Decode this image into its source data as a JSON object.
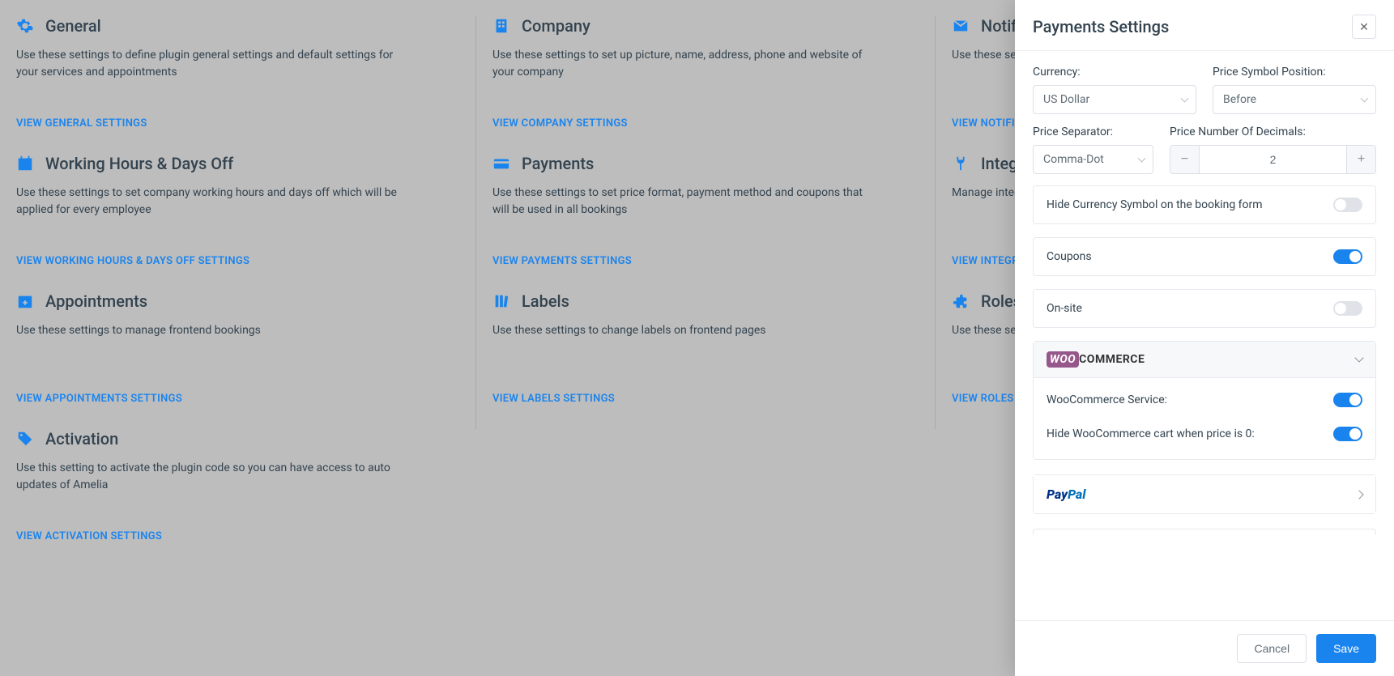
{
  "cards": [
    {
      "icon": "gear",
      "title": "General",
      "desc": "Use these settings to define plugin general settings and default settings for your services and appointments",
      "link": "VIEW GENERAL SETTINGS"
    },
    {
      "icon": "building",
      "title": "Company",
      "desc": "Use these settings to set up picture, name, address, phone and website of your company",
      "link": "VIEW COMPANY SETTINGS"
    },
    {
      "icon": "envelope",
      "title": "Notifications",
      "desc": "Use these settings to configure what notifications are sent to customers",
      "link": "VIEW NOTIFICATIONS SETTINGS"
    },
    {
      "icon": "calendar",
      "title": "Working Hours & Days Off",
      "desc": "Use these settings to set company working hours and days off which will be applied for every employee",
      "link": "VIEW WORKING HOURS & DAYS OFF SETTINGS"
    },
    {
      "icon": "card",
      "title": "Payments",
      "desc": "Use these settings to set price format, payment method and coupons that will be used in all bookings",
      "link": "VIEW PAYMENTS SETTINGS"
    },
    {
      "icon": "plug",
      "title": "Integrations",
      "desc": "Manage integrations",
      "link": "VIEW INTEGRATIONS SETTINGS"
    },
    {
      "icon": "cal-plus",
      "title": "Appointments",
      "desc": "Use these settings to manage frontend bookings",
      "link": "VIEW APPOINTMENTS SETTINGS"
    },
    {
      "icon": "books",
      "title": "Labels",
      "desc": "Use these settings to change labels on frontend pages",
      "link": "VIEW LABELS SETTINGS"
    },
    {
      "icon": "puzzle",
      "title": "Roles",
      "desc": "Use these settings to manage roles",
      "link": "VIEW ROLES SETTINGS"
    },
    {
      "icon": "tag",
      "title": "Activation",
      "desc": "Use this setting to activate the plugin code so you can have access to auto updates of Amelia",
      "link": "VIEW ACTIVATION SETTINGS"
    }
  ],
  "panel": {
    "title": "Payments Settings",
    "currency_label": "Currency:",
    "currency_value": "US Dollar",
    "position_label": "Price Symbol Position:",
    "position_value": "Before",
    "separator_label": "Price Separator:",
    "separator_value": "Comma-Dot",
    "decimals_label": "Price Number Of Decimals:",
    "decimals_value": "2",
    "hide_symbol_label": "Hide Currency Symbol on the booking form",
    "hide_symbol_on": false,
    "coupons_label": "Coupons",
    "coupons_on": true,
    "onsite_label": "On-site",
    "onsite_on": false,
    "woo_service_label": "WooCommerce Service:",
    "woo_service_on": true,
    "woo_hide_label": "Hide WooCommerce cart when price is 0:",
    "woo_hide_on": true,
    "cancel": "Cancel",
    "save": "Save"
  }
}
